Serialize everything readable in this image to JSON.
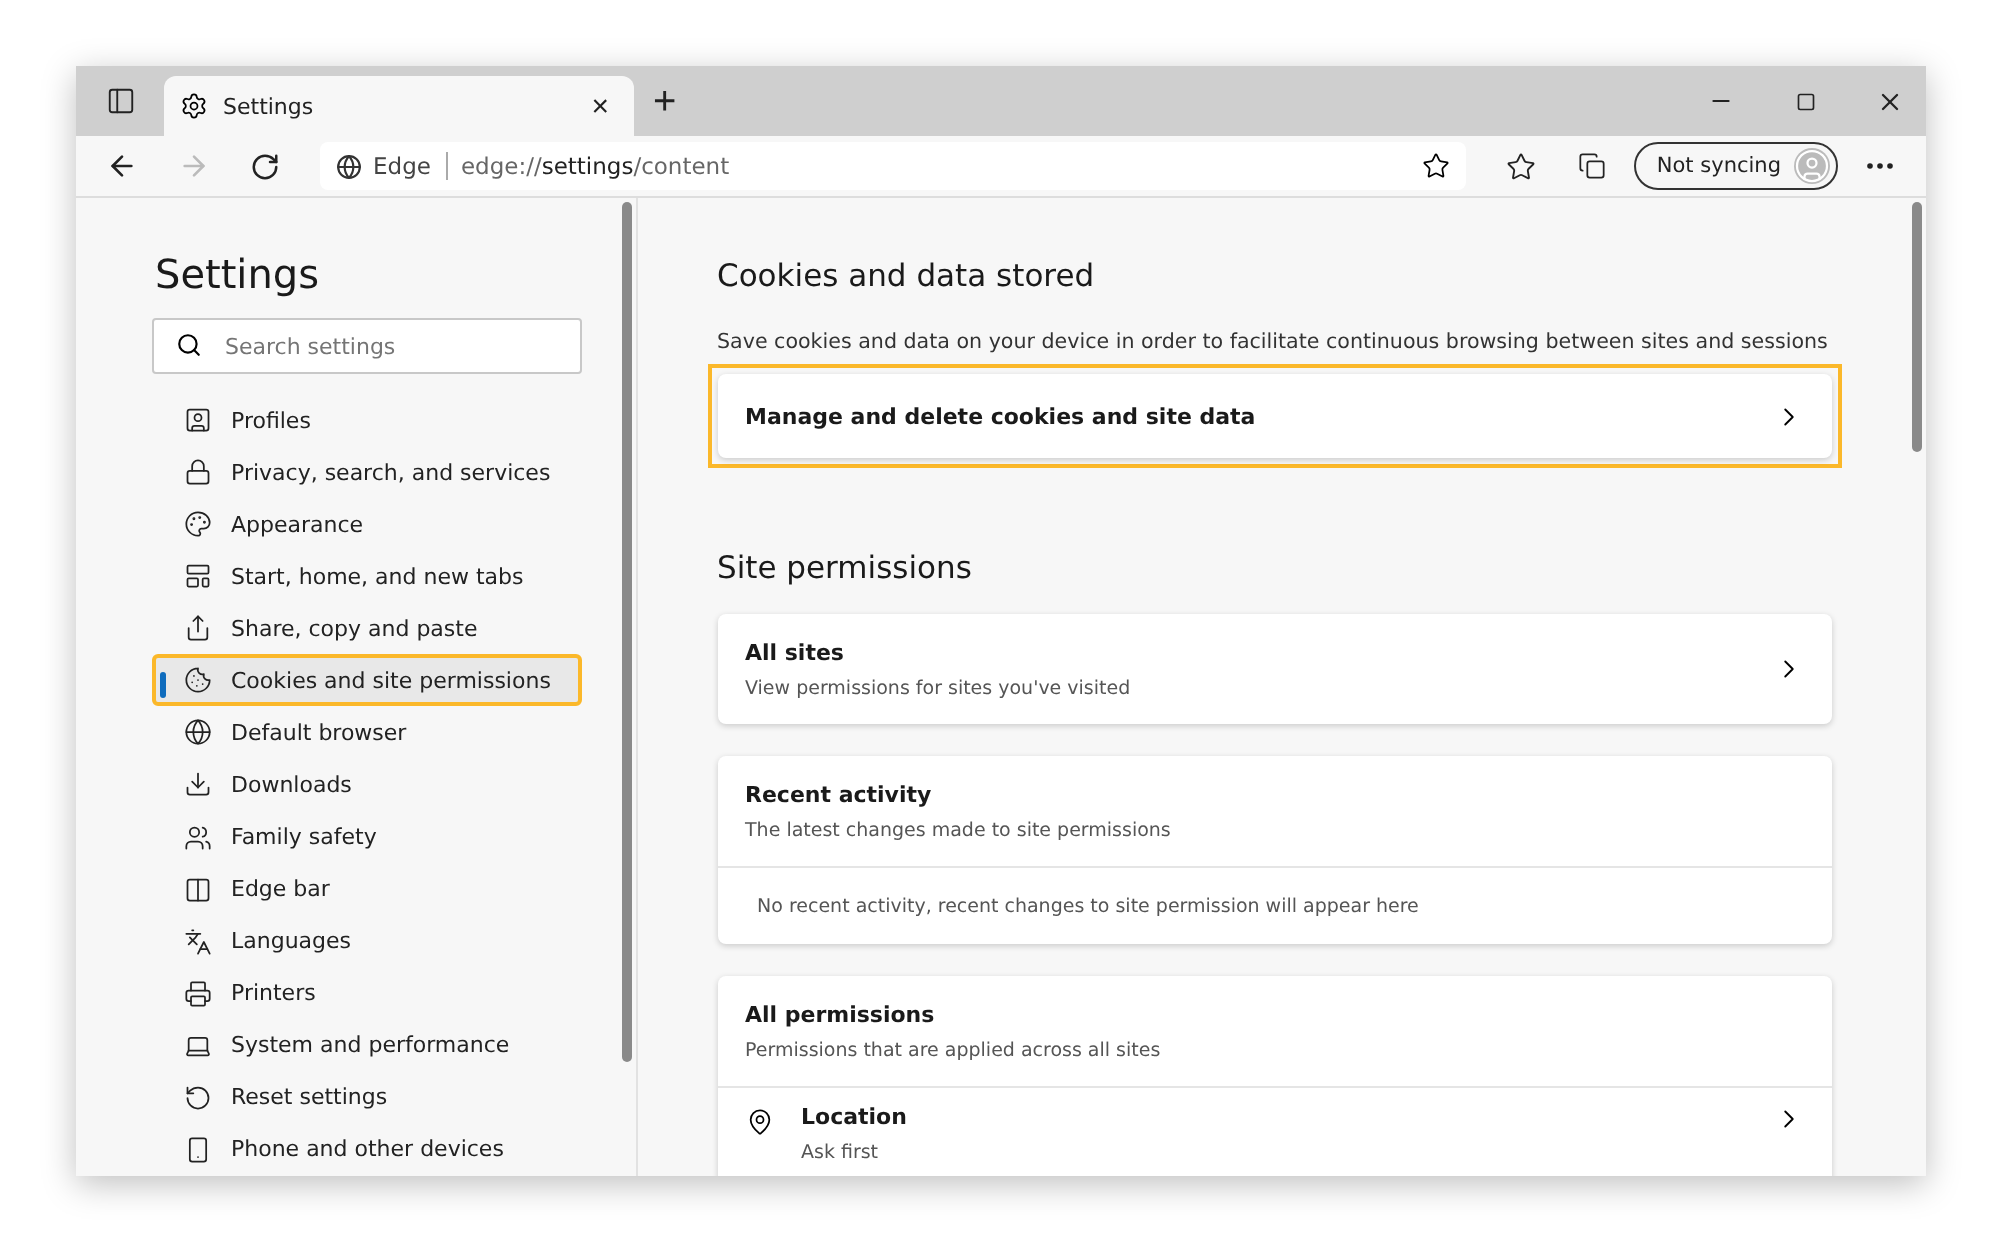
{
  "browser": {
    "tab": {
      "title": "Settings",
      "close": "×"
    },
    "new_tab": "+",
    "address": {
      "site": "Edge",
      "url_prefix": "edge://",
      "url_bold": "settings",
      "url_suffix": "/content"
    },
    "profile": {
      "label": "Not syncing"
    }
  },
  "sidebar": {
    "title": "Settings",
    "search": {
      "placeholder": "Search settings"
    },
    "items": [
      {
        "label": "Profiles",
        "selected": false,
        "highlighted": false
      },
      {
        "label": "Privacy, search, and services",
        "selected": false,
        "highlighted": false
      },
      {
        "label": "Appearance",
        "selected": false,
        "highlighted": false
      },
      {
        "label": "Start, home, and new tabs",
        "selected": false,
        "highlighted": false
      },
      {
        "label": "Share, copy and paste",
        "selected": false,
        "highlighted": false
      },
      {
        "label": "Cookies and site permissions",
        "selected": true,
        "highlighted": true
      },
      {
        "label": "Default browser",
        "selected": false,
        "highlighted": false
      },
      {
        "label": "Downloads",
        "selected": false,
        "highlighted": false
      },
      {
        "label": "Family safety",
        "selected": false,
        "highlighted": false
      },
      {
        "label": "Edge bar",
        "selected": false,
        "highlighted": false
      },
      {
        "label": "Languages",
        "selected": false,
        "highlighted": false
      },
      {
        "label": "Printers",
        "selected": false,
        "highlighted": false
      },
      {
        "label": "System and performance",
        "selected": false,
        "highlighted": false
      },
      {
        "label": "Reset settings",
        "selected": false,
        "highlighted": false
      },
      {
        "label": "Phone and other devices",
        "selected": false,
        "highlighted": false
      }
    ]
  },
  "main": {
    "cookies_section": {
      "heading": "Cookies and data stored",
      "description": "Save cookies and data on your device in order to facilitate continuous browsing between sites and sessions",
      "link_card": {
        "label": "Manage and delete cookies and site data",
        "highlighted": true
      }
    },
    "permissions_section": {
      "heading": "Site permissions",
      "cards": [
        {
          "title": "All sites",
          "subtitle": "View permissions for sites you've visited",
          "chevron": true
        },
        {
          "title": "Recent activity",
          "subtitle": "The latest changes made to site permissions",
          "chevron": false,
          "body": "No recent activity, recent changes to site permission will appear here"
        },
        {
          "title": "All permissions",
          "subtitle": "Permissions that are applied across all sites",
          "chevron": false,
          "rows": [
            {
              "label": "Location",
              "detail": "Ask first"
            }
          ]
        }
      ]
    }
  }
}
